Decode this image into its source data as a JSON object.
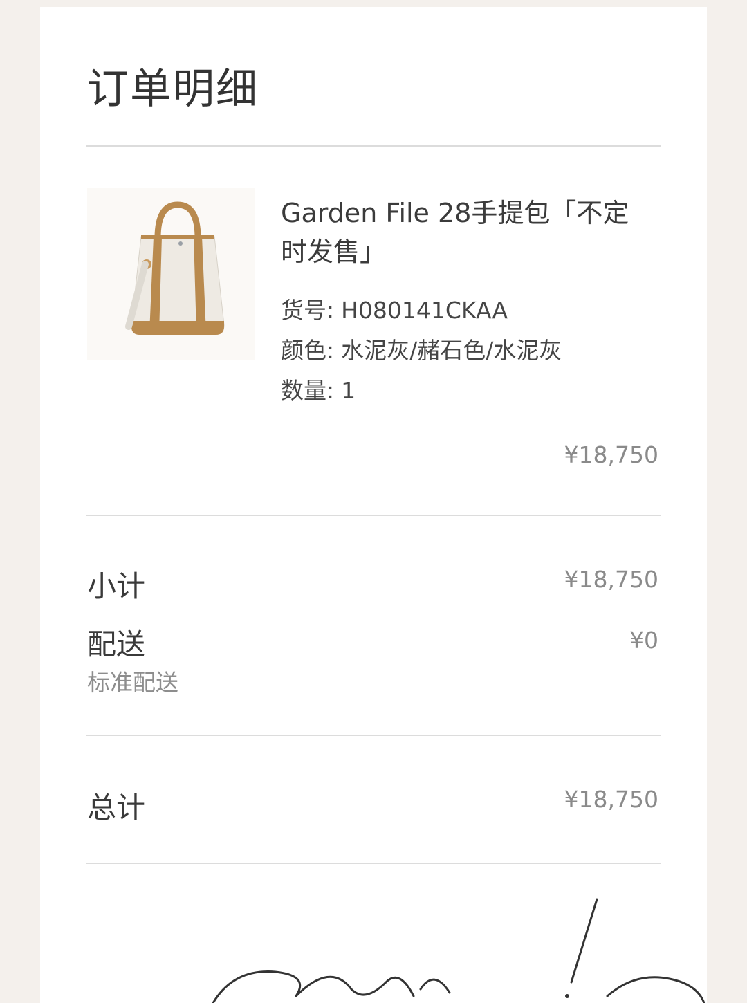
{
  "order": {
    "title": "订单明细"
  },
  "item": {
    "name": "Garden File 28手提包「不定时发售」",
    "sku_label": "货号:",
    "sku_value": "H080141CKAA",
    "color_label": "颜色:",
    "color_value": "水泥灰/赭石色/水泥灰",
    "qty_label": "数量:",
    "qty_value": "1",
    "price": "¥18,750"
  },
  "summary": {
    "subtotal_label": "小计",
    "subtotal_value": "¥18,750",
    "shipping_label": "配送",
    "shipping_method": "标准配送",
    "shipping_value": "¥0",
    "total_label": "总计",
    "total_value": "¥18,750"
  },
  "colors": {
    "background": "#f4f0ec",
    "card": "#ffffff",
    "bag_canvas": "#eeeae3",
    "bag_leather": "#b98a4e"
  }
}
